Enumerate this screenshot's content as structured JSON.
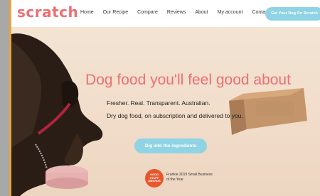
{
  "brand": {
    "logo": "scratch"
  },
  "nav": {
    "items": [
      "Home",
      "Our Recipe",
      "Compare",
      "Reviews",
      "About",
      "My account",
      "Contact"
    ],
    "cta": "Get Your Dog On Scratch"
  },
  "hero": {
    "headline": "Dog food you'll feel good about",
    "tagline": "Fresher. Real. Transparent. Australian.",
    "description": "Dry dog food, on subscription and delivered to you.",
    "button": "Dig into the ingredients"
  },
  "award": {
    "badge": "GOOD STUFF AWARDS",
    "text": "Frankie 2019 Small Business of the Year"
  },
  "colors": {
    "brand": "#ee6e73",
    "accent": "#8fd3e4",
    "background": "#f0e0cf"
  }
}
